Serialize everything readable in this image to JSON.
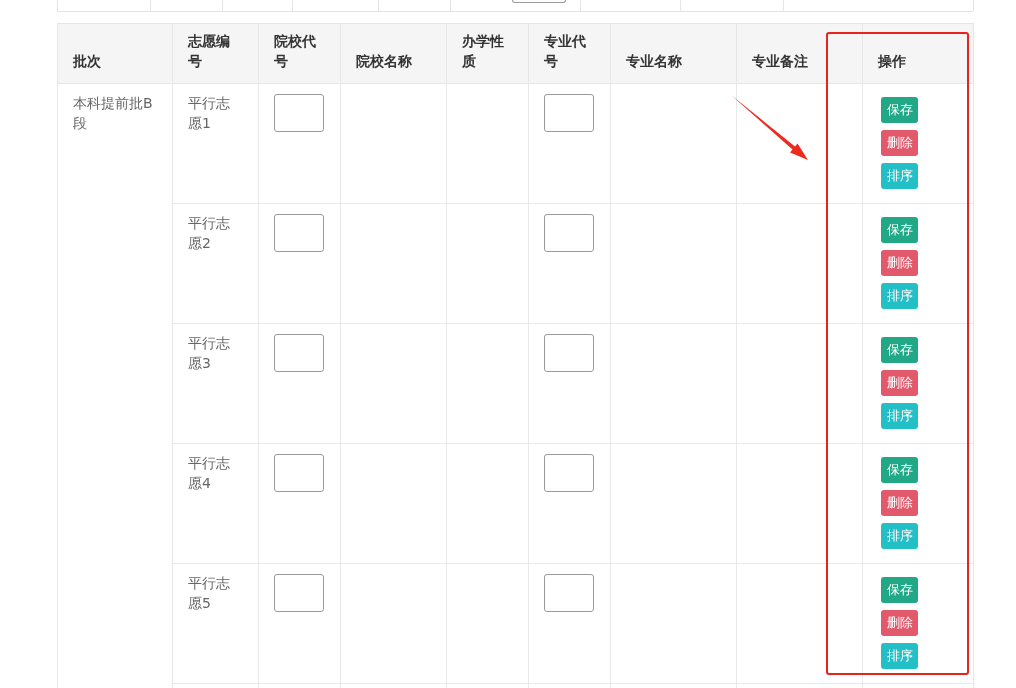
{
  "table": {
    "columns": [
      {
        "label": "批次",
        "kind": "batch"
      },
      {
        "label": "志愿编号",
        "kind": "number"
      },
      {
        "label": "院校代号",
        "kind": "input"
      },
      {
        "label": "院校名称",
        "kind": "text"
      },
      {
        "label": "办学性质",
        "kind": "text"
      },
      {
        "label": "专业代号",
        "kind": "input"
      },
      {
        "label": "专业名称",
        "kind": "text"
      },
      {
        "label": "专业备注",
        "kind": "text"
      },
      {
        "label": "操作",
        "kind": "actions"
      }
    ],
    "batch": "本科提前批B段",
    "rows": [
      {
        "number": "平行志愿1",
        "actions": [
          {
            "kind": "save",
            "label": "保存"
          },
          {
            "kind": "delete",
            "label": "删除"
          },
          {
            "kind": "sort",
            "label": "排序"
          }
        ]
      },
      {
        "number": "平行志愿2",
        "actions": [
          {
            "kind": "save",
            "label": "保存"
          },
          {
            "kind": "delete",
            "label": "删除"
          },
          {
            "kind": "sort",
            "label": "排序"
          }
        ]
      },
      {
        "number": "平行志愿3",
        "actions": [
          {
            "kind": "save",
            "label": "保存"
          },
          {
            "kind": "delete",
            "label": "删除"
          },
          {
            "kind": "sort",
            "label": "排序"
          }
        ]
      },
      {
        "number": "平行志愿4",
        "actions": [
          {
            "kind": "save",
            "label": "保存"
          },
          {
            "kind": "delete",
            "label": "删除"
          },
          {
            "kind": "sort",
            "label": "排序"
          }
        ]
      },
      {
        "number": "平行志愿5",
        "actions": [
          {
            "kind": "save",
            "label": "保存"
          },
          {
            "kind": "delete",
            "label": "删除"
          },
          {
            "kind": "sort",
            "label": "排序"
          }
        ]
      }
    ]
  },
  "annotation": {
    "highlight_box": true,
    "arrow": true
  }
}
